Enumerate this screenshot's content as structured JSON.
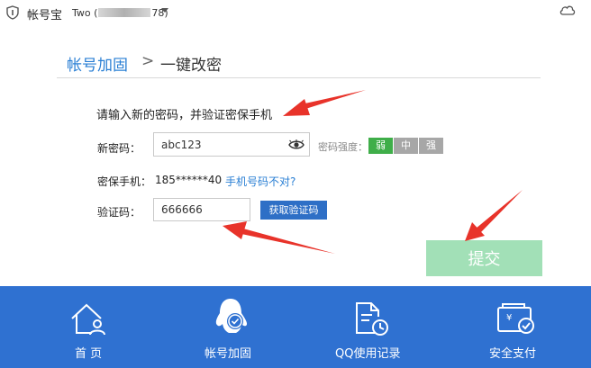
{
  "titlebar": {
    "app_name": "帐号宝",
    "account_prefix": "Two (",
    "account_suffix": "78)"
  },
  "breadcrumb": {
    "parent": "帐号加固",
    "separator": ">",
    "current": "一键改密"
  },
  "form": {
    "instruction": "请输入新的密码，并验证密保手机",
    "new_password_label": "新密码：",
    "new_password_value": "abc123",
    "strength_label": "密码强度：",
    "strength_levels": [
      "弱",
      "中",
      "强"
    ],
    "strength_selected": "弱",
    "phone_label": "密保手机：",
    "phone_value": "185******40",
    "phone_link": "手机号码不对?",
    "code_label": "验证码：",
    "code_value": "666666",
    "get_code_button": "获取验证码",
    "submit_button": "提交"
  },
  "bottom_nav": {
    "items": [
      {
        "label": "首 页",
        "icon": "home-user-icon"
      },
      {
        "label": "帐号加固",
        "icon": "qq-penguin-shield-icon"
      },
      {
        "label": "QQ使用记录",
        "icon": "document-clock-icon"
      },
      {
        "label": "安全支付",
        "icon": "wallet-check-icon"
      }
    ]
  },
  "colors": {
    "accent_blue": "#2f71d1",
    "link_blue": "#2a7fd4",
    "strength_weak": "#3fae49",
    "submit_disabled": "#a2e0b7",
    "annotation_arrow": "#e8332a"
  }
}
